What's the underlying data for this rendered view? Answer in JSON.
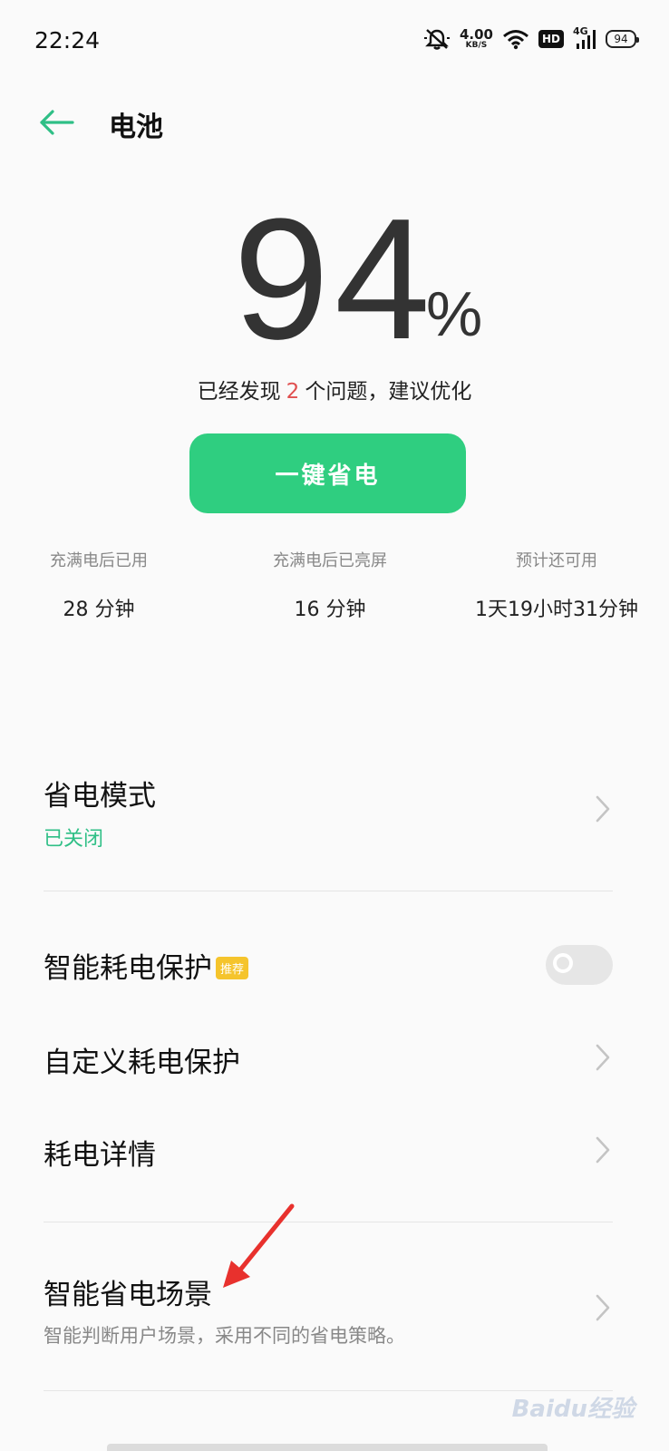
{
  "status_bar": {
    "time": "22:24",
    "net_speed_value": "4.00",
    "net_speed_unit": "KB/S",
    "hd_label": "HD",
    "signal_label": "4G",
    "battery_level": "94"
  },
  "header": {
    "title": "电池"
  },
  "battery": {
    "percent": "94",
    "percent_sign": "%",
    "issues_prefix": "已经发现",
    "issues_count": "2",
    "issues_suffix": "个问题，建议优化"
  },
  "optimize_button": {
    "label": "一键省电"
  },
  "stats": [
    {
      "label": "充满电后已用",
      "value": "28 分钟"
    },
    {
      "label": "充满电后已亮屏",
      "value": "16 分钟"
    },
    {
      "label": "预计还可用",
      "value": "1天19小时31分钟"
    }
  ],
  "settings": {
    "power_saving_mode": {
      "title": "省电模式",
      "status": "已关闭"
    },
    "smart_protection": {
      "title": "智能耗电保护",
      "badge": "推荐",
      "enabled": false
    },
    "custom_protection": {
      "title": "自定义耗电保护"
    },
    "usage_details": {
      "title": "耗电详情"
    },
    "smart_scenes": {
      "title": "智能省电场景",
      "subtitle": "智能判断用户场景，采用不同的省电策略。"
    }
  },
  "colors": {
    "accent": "#2fce80",
    "issue_highlight": "#e05050",
    "badge": "#f5c42c",
    "annotation_arrow": "#e8312d"
  },
  "watermark": "Baidu经验"
}
